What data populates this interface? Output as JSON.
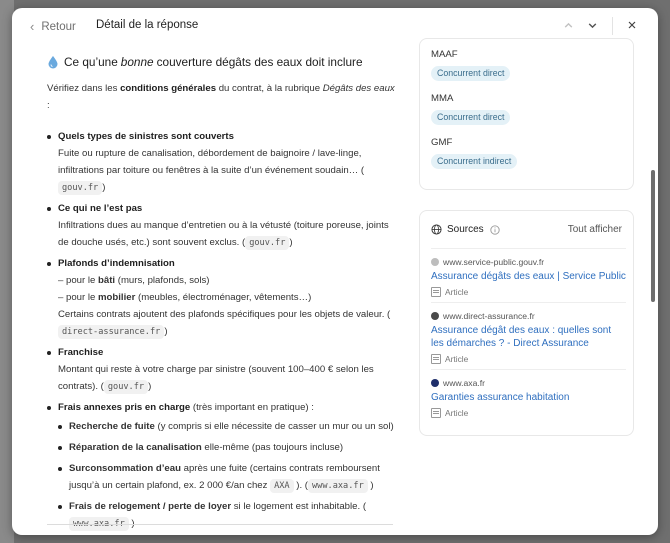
{
  "topbar": {
    "back_label": "Retour",
    "title": "Détail de la réponse"
  },
  "article": {
    "heading_prefix": "Ce qu’une ",
    "heading_em": "bonne",
    "heading_suffix": " couverture dégâts des eaux doit inclure",
    "intro_a": "Vérifiez dans les ",
    "intro_b": "conditions générales",
    "intro_c": " du contrat, à la rubrique ",
    "intro_d": "Dégâts des eaux",
    "intro_e": " :",
    "items": [
      {
        "title": "Quels types de sinistres sont couverts",
        "text": "Fuite ou rupture de canalisation, débordement de baignoire / lave-linge, infiltrations par toiture ou fenêtres à la suite d’un événement soudain… (",
        "chip": "gouv.fr",
        "tail": ")"
      },
      {
        "title": "Ce qui ne l’est pas",
        "text": "Infiltrations dues au manque d’entretien ou à la vétusté (toiture poreuse, joints de douche usés, etc.) sont souvent exclus. (",
        "chip": "gouv.fr",
        "tail": ")"
      },
      {
        "title": "Plafonds d’indemnisation",
        "line1a": "– pour le ",
        "line1b": "bâti",
        "line1c": " (murs, plafonds, sols)",
        "line2a": "– pour le ",
        "line2b": "mobilier",
        "line2c": " (meubles, électroménager, vêtements…)",
        "text": "Certains contrats ajoutent des plafonds spécifiques pour les objets de valeur. (",
        "chip": "direct-assurance.fr",
        "tail": ")"
      },
      {
        "title": "Franchise",
        "text": "Montant qui reste à votre charge par sinistre (souvent 100–400 € selon les contrats). (",
        "chip": "gouv.fr",
        "tail": ")"
      },
      {
        "title": "Frais annexes pris en charge",
        "title_tail": " (très important en pratique) :",
        "sub": [
          {
            "title": "Recherche de fuite",
            "text": " (y compris si elle nécessite de casser un mur ou un sol)"
          },
          {
            "title": "Réparation de la canalisation",
            "text": " elle-même (pas toujours incluse)"
          },
          {
            "title": "Surconsommation d’eau",
            "text": " après une fuite (certains contrats remboursent jusqu’à un certain plafond, ex. 2 000 €/an chez ",
            "chip1": "AXA",
            "mid": " ). (",
            "chip2": "www.axa.fr",
            "tail": " )"
          },
          {
            "title": "Frais de relogement / perte de loyer",
            "text": " si le logement est inhabitable. (",
            "chip": "www.axa.fr",
            "tail": " )"
          }
        ]
      }
    ]
  },
  "competitors": [
    {
      "name": "MAAF",
      "badge": "Concurrent direct"
    },
    {
      "name": "MMA",
      "badge": "Concurrent direct"
    },
    {
      "name": "GMF",
      "badge": "Concurrent indirect"
    }
  ],
  "sources": {
    "title": "Sources",
    "show_all": "Tout afficher",
    "items": [
      {
        "domain": "www.service-public.gouv.fr",
        "title": "Assurance dégâts des eaux | Service Public",
        "type": "Article",
        "favicon_color": "#bdbdbd"
      },
      {
        "domain": "www.direct-assurance.fr",
        "title": "Assurance dégât des eaux : quelles sont les démarches ? - Direct Assurance",
        "type": "Article",
        "favicon_color": "#4a4a4a"
      },
      {
        "domain": "www.axa.fr",
        "title": "Garanties assurance habitation",
        "type": "Article",
        "favicon_color": "#1f2f6b"
      }
    ]
  },
  "colors": {
    "link": "#2f6fbf",
    "badge_bg": "#e4f1f7",
    "badge_text": "#3a6d8c"
  }
}
